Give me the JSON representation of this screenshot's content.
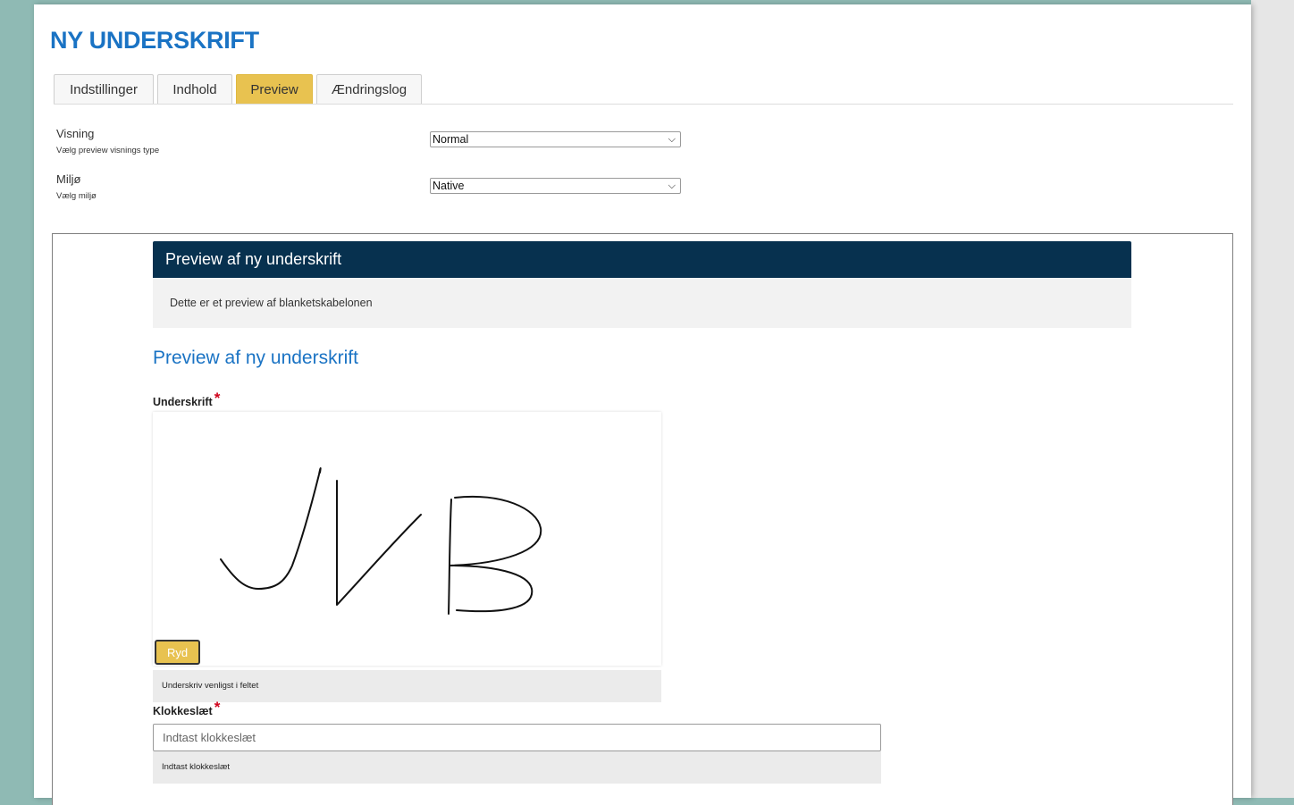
{
  "page": {
    "title": "NY UNDERSKRIFT"
  },
  "tabs": [
    {
      "label": "Indstillinger",
      "active": false
    },
    {
      "label": "Indhold",
      "active": false
    },
    {
      "label": "Preview",
      "active": true
    },
    {
      "label": "Ændringslog",
      "active": false
    }
  ],
  "settings": {
    "visning": {
      "label": "Visning",
      "help": "Vælg preview visnings type",
      "value": "Normal"
    },
    "miljo": {
      "label": "Miljø",
      "help": "Vælg miljø",
      "value": "Native"
    }
  },
  "preview": {
    "header": "Preview af ny underskrift",
    "note": "Dette er et preview af blanketskabelonen",
    "heading": "Preview af ny underskrift",
    "signature": {
      "label": "Underskrift",
      "required_mark": "*",
      "clear_label": "Ryd",
      "hint": "Underskriv venligst i feltet"
    },
    "time": {
      "label": "Klokkeslæt",
      "required_mark": "*",
      "placeholder": "Indtast klokkeslæt",
      "hint": "Indtast klokkeslæt"
    }
  },
  "colors": {
    "title_blue": "#1a73c4",
    "active_tab": "#e8c250",
    "header_navy": "#07314f",
    "required_red": "#d0021b",
    "backdrop": "#8fbab4"
  }
}
